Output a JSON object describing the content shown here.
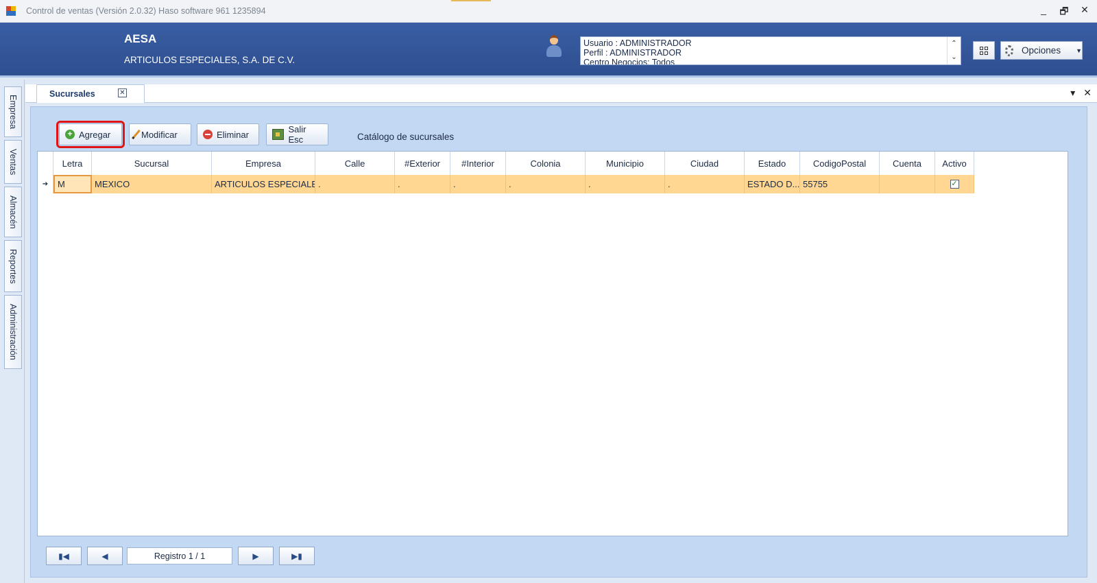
{
  "window": {
    "title": "Control de ventas  (Versión 2.0.32)  Haso software  961 1235894",
    "minimize_label": "_",
    "restore_label": "🗗",
    "close_label": "✕"
  },
  "header": {
    "company_short": "AESA",
    "company_long": "ARTICULOS ESPECIALES, S.A. DE C.V.",
    "user_lines": [
      "Usuario : ADMINISTRADOR",
      "Perfil : ADMINISTRADOR",
      "Centro Negocios: Todos"
    ],
    "options_label": "Opciones"
  },
  "sidebar": {
    "tabs": [
      {
        "label": "Empresa"
      },
      {
        "label": "Ventas"
      },
      {
        "label": "Almacén"
      },
      {
        "label": "Reportes"
      },
      {
        "label": "Administración"
      }
    ]
  },
  "doc_tab": {
    "label": "Sucursales",
    "close_label": "✕"
  },
  "toolbar": {
    "agregar": "Agregar",
    "modificar": "Modificar",
    "eliminar": "Eliminar",
    "salir": "Salir  Esc",
    "catalog_title": "Catálogo de sucursales"
  },
  "grid": {
    "columns": [
      "Letra",
      "Sucursal",
      "Empresa",
      "Calle",
      "#Exterior",
      "#Interior",
      "Colonia",
      "Municipio",
      "Ciudad",
      "Estado",
      "CodigoPostal",
      "Cuenta",
      "Activo"
    ],
    "rows": [
      {
        "letra": "M",
        "sucursal": "MEXICO",
        "empresa": "ARTICULOS ESPECIALE...",
        "calle": ".",
        "exterior": ".",
        "interior": ".",
        "colonia": ".",
        "municipio": ".",
        "ciudad": ".",
        "estado": "ESTADO D...",
        "codigo_postal": "55755",
        "cuenta": "",
        "activo": true
      }
    ]
  },
  "navigator": {
    "record_label": "Registro  1 / 1"
  }
}
